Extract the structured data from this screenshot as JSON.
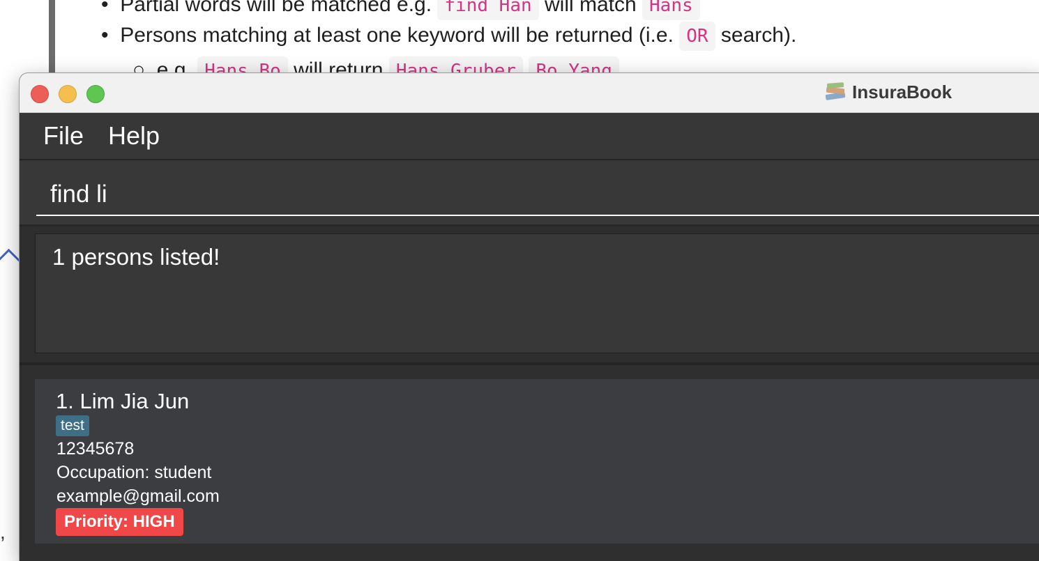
{
  "doc": {
    "line1": {
      "prefix": "Partial words will be matched e.g.",
      "code1": "find Han",
      "middle": "will match",
      "code2": "Hans"
    },
    "line2": {
      "prefix": "Persons matching at least one keyword will be returned (i.e.",
      "code": "OR",
      "suffix": "search)."
    },
    "line3": {
      "prefix": "e.g.",
      "code1": "Hans Bo",
      "middle": "will return",
      "code2": "Hans Gruber",
      "code3": "Bo Yang"
    }
  },
  "window": {
    "title": "InsuraBook",
    "app_icon": "books-icon",
    "traffic_lights": {
      "close": "#ee5e58",
      "minimize": "#f5bf4f",
      "zoom": "#5fc651"
    }
  },
  "menu": {
    "file": "File",
    "help": "Help"
  },
  "command": {
    "value": "find li"
  },
  "result": {
    "message": "1 persons listed!"
  },
  "persons": [
    {
      "index_name": "1. Lim Jia Jun",
      "tag": "test",
      "phone": "12345678",
      "occupation": "Occupation: student",
      "email": "example@gmail.com",
      "priority": "Priority: HIGH",
      "priority_color": "#f04848",
      "tag_color": "#3f6f86"
    }
  ]
}
